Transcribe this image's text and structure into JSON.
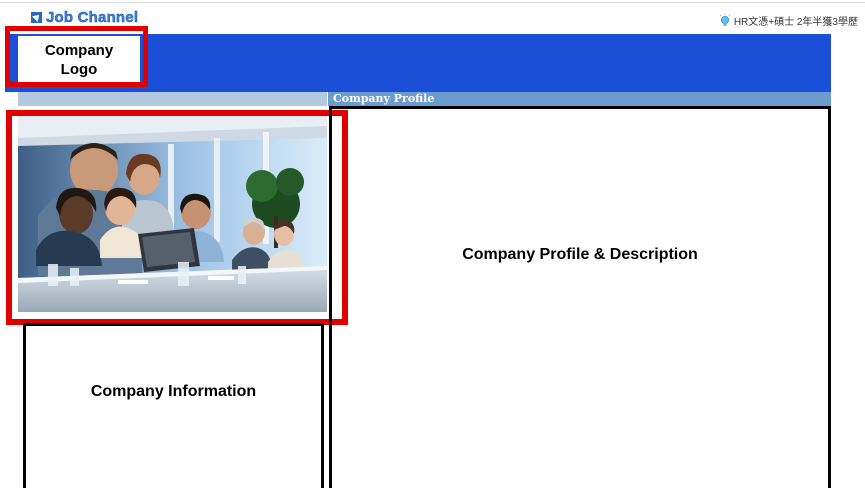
{
  "header": {
    "brand": "Job Channel",
    "brand_icon": "job-channel-icon",
    "hr_info": "HR文憑+碩士 2年半獲3學歷",
    "hr_icon": "lightbulb-icon"
  },
  "logo": {
    "label": "Company\nLogo"
  },
  "profile": {
    "header": "Company Profile",
    "body": "Company Profile & Description"
  },
  "info": {
    "body": "Company Information"
  },
  "colors": {
    "banner": "#1c4fd8",
    "highlight": "#e00000",
    "profile_header": "#6c9ccf"
  }
}
